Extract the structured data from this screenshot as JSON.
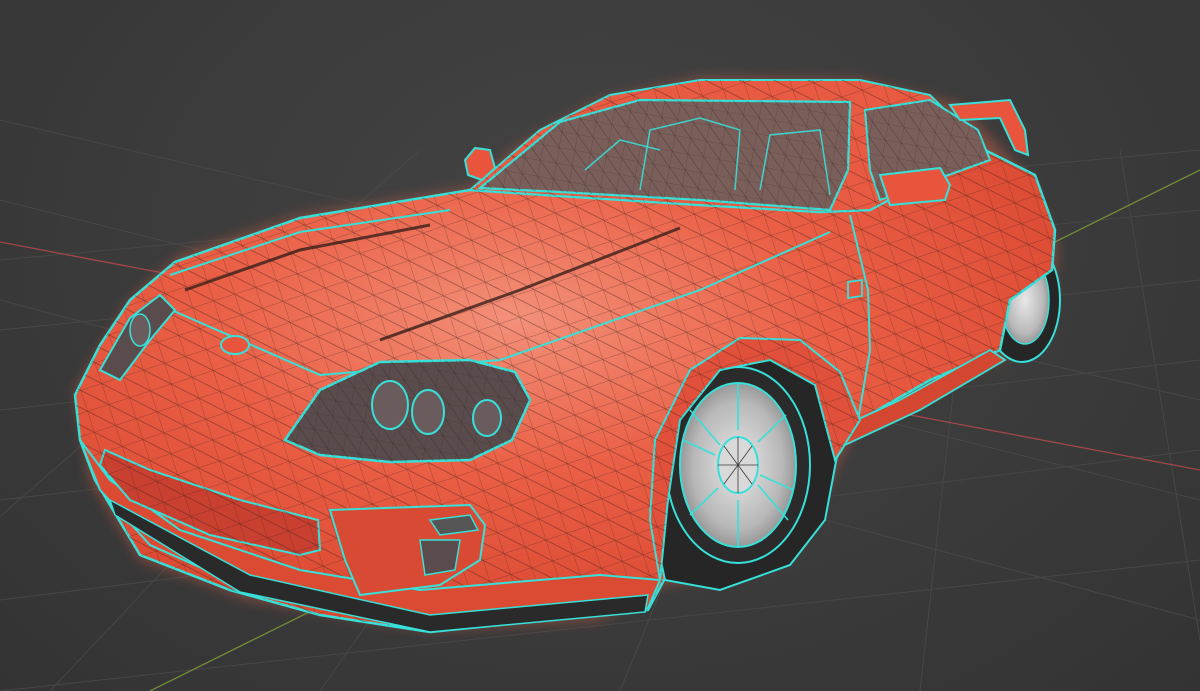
{
  "viewport": {
    "background_color": "#3b3b3b",
    "grid_color": "#4a4a4a",
    "x_axis_color": "#b34a4a",
    "y_axis_color": "#7a9a3a"
  },
  "object": {
    "name_icon": "car-mesh-icon",
    "body_color": "#e8553c",
    "body_highlight_color": "#f28a72",
    "wire_color": "#3a1f1a",
    "selection_outline_color": "#37e0d8",
    "glass_color": "#7a5e5a",
    "tire_color": "#262626",
    "rim_color": "#cfcfcf"
  }
}
